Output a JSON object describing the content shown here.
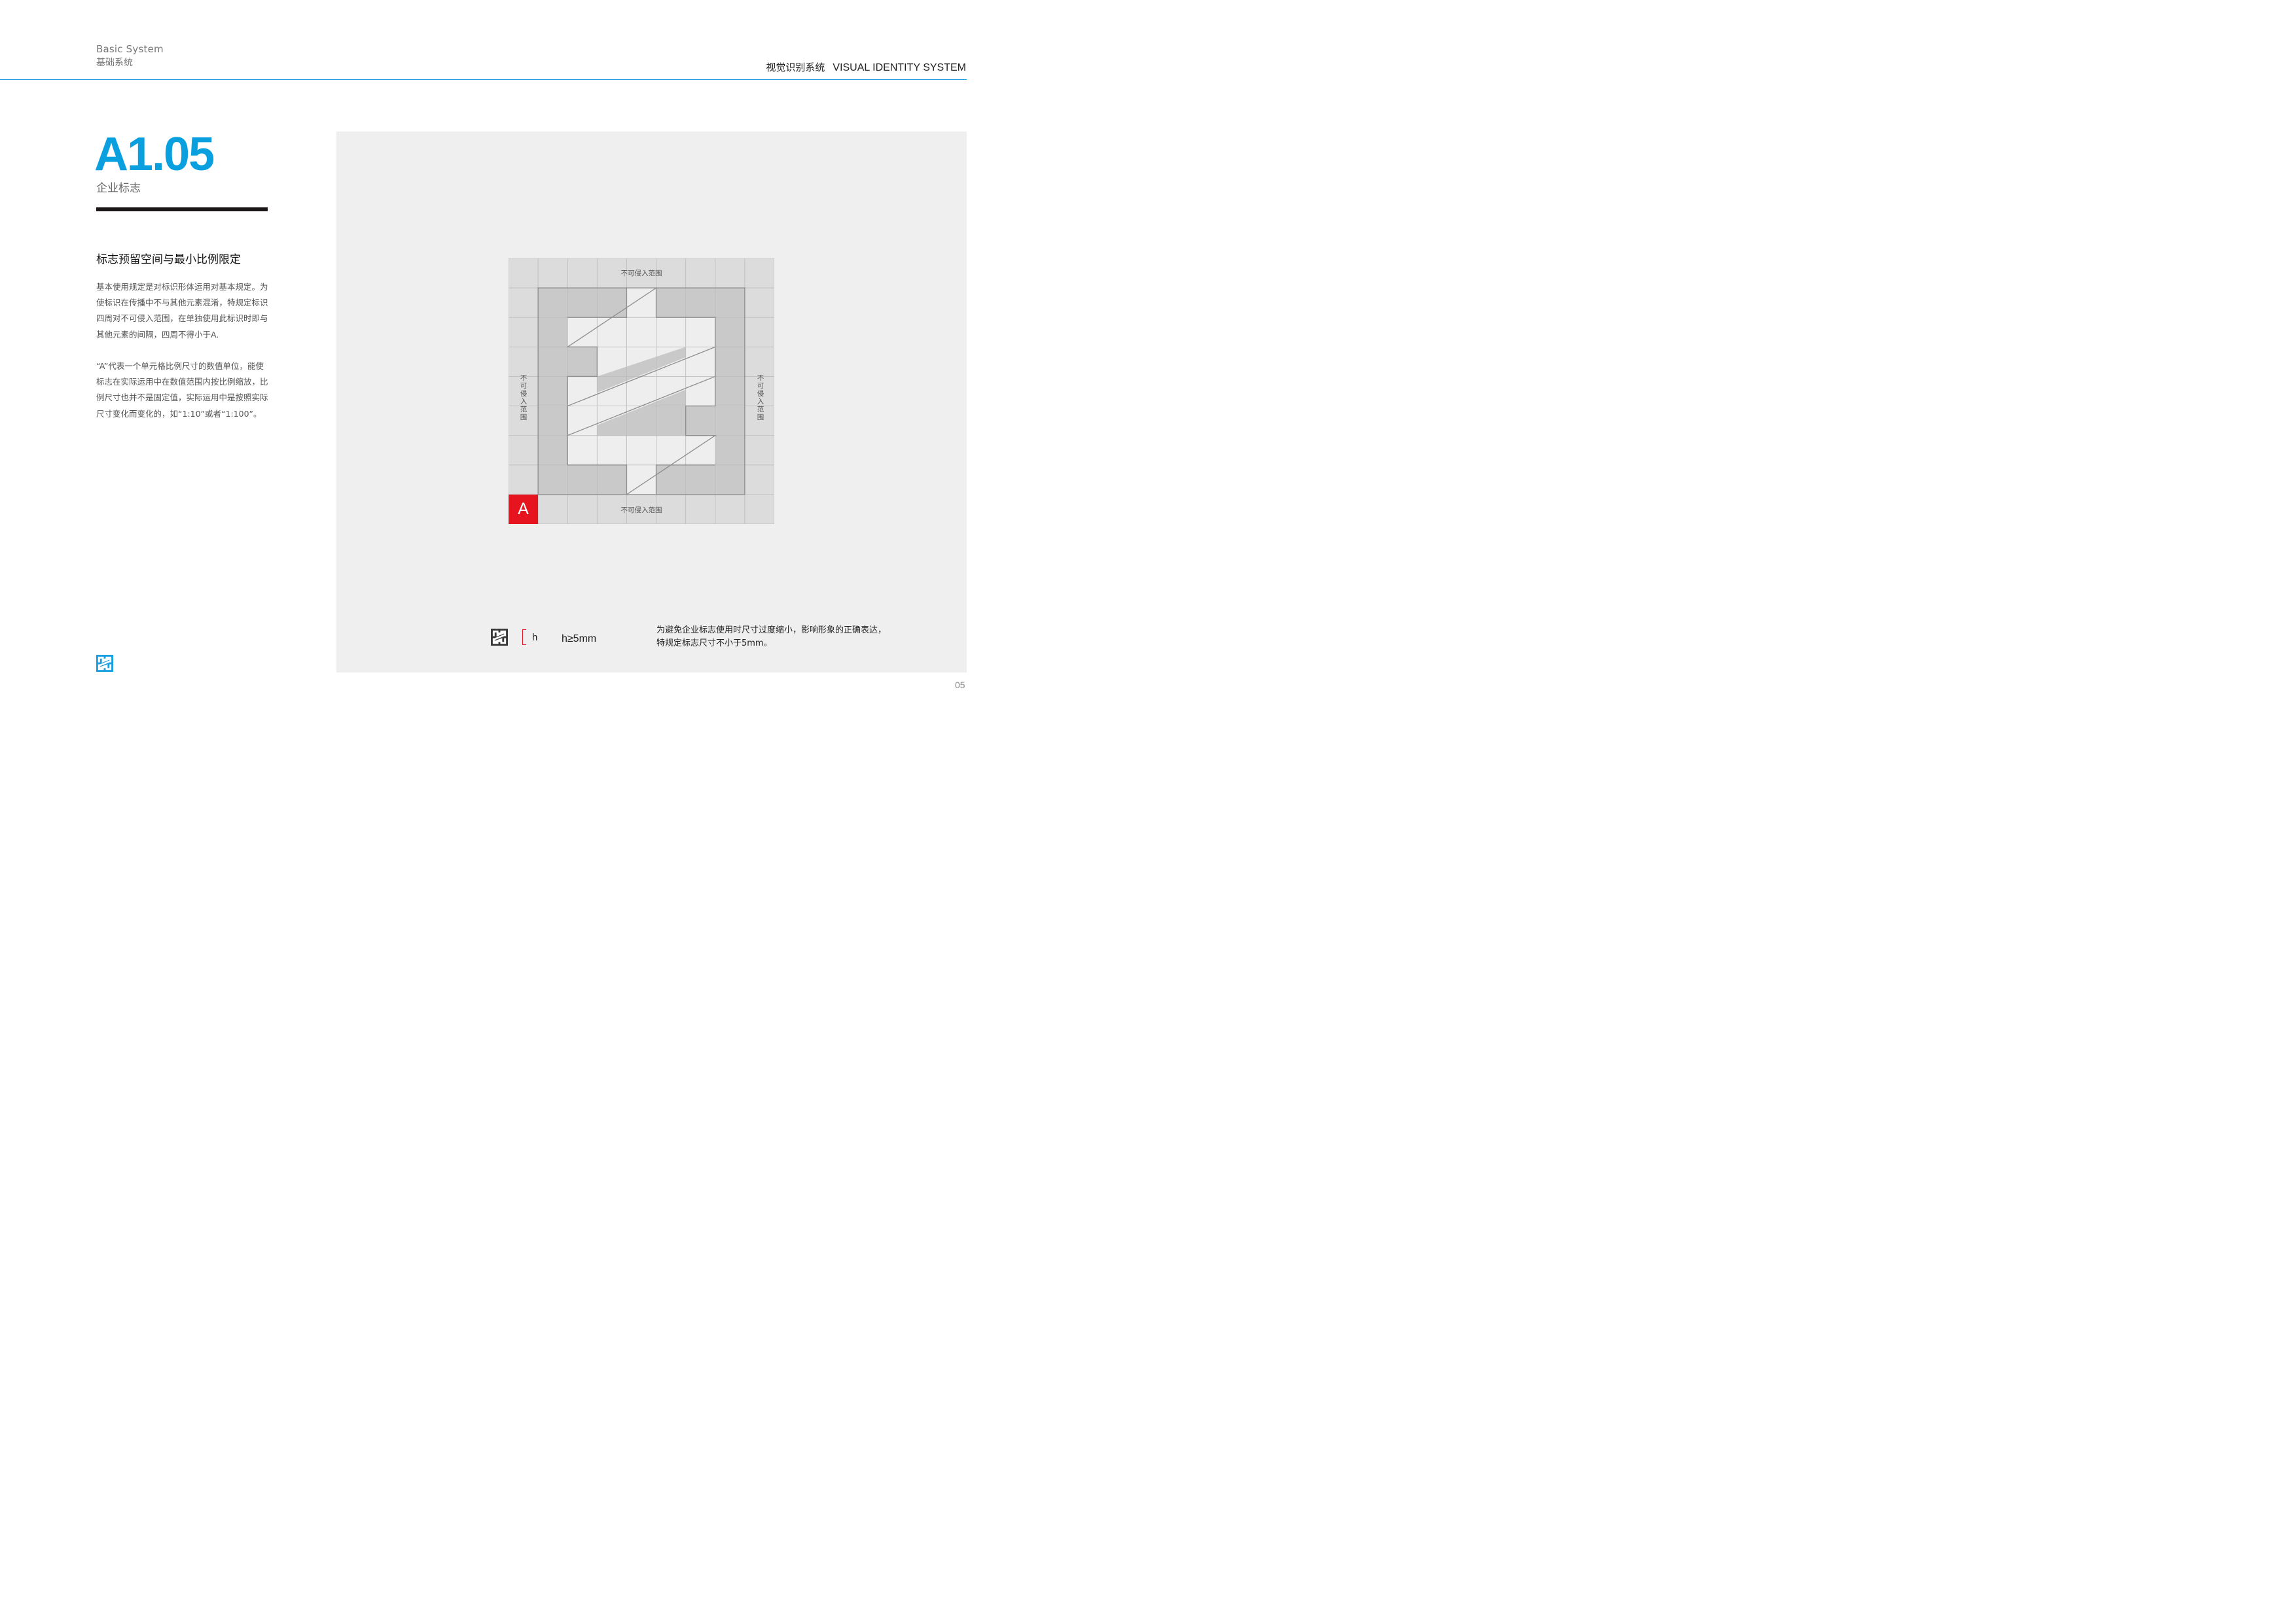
{
  "header": {
    "section_en": "Basic System",
    "section_cn": "基础系统",
    "system_cn": "视觉识别系统",
    "system_en": "VISUAL IDENTITY SYSTEM"
  },
  "section": {
    "code": "A1.05",
    "name": "企业标志"
  },
  "content": {
    "title": "标志预留空间与最小比例限定",
    "paragraphs": [
      "基本使用规定是对标识形体运用对基本规定。为使标识在传播中不与其他元素混淆，特规定标识四周对不可侵入范围，在单独使用此标识时即与其他元素的间隔，四周不得小于A.",
      "“A”代表一个单元格比例尺寸的数值单位，能使标志在实际运用中在数值范围内按比例缩放，比例尺寸也并不是固定值，实际运用中是按照实际尺寸变化而变化的，如“1:10”或者“1:100”。"
    ]
  },
  "diagram": {
    "zone_label": "不可侵入范围",
    "unit_label": "A",
    "unit_color": "#e5141f",
    "min_size": {
      "h_label": "h",
      "rule": "h≥5mm",
      "note_line1": "为避免企业标志使用时尺寸过度缩小，影响形象的正确表达，",
      "note_line2": "特规定标志尺寸不小于5mm。"
    }
  },
  "colors": {
    "accent_blue": "#0aa0e0",
    "rule_blue": "#29a0d8",
    "panel_bg": "#efefef"
  },
  "icons": [
    "brand-logo-icon",
    "mini-logo-icon"
  ],
  "page_number": "05"
}
